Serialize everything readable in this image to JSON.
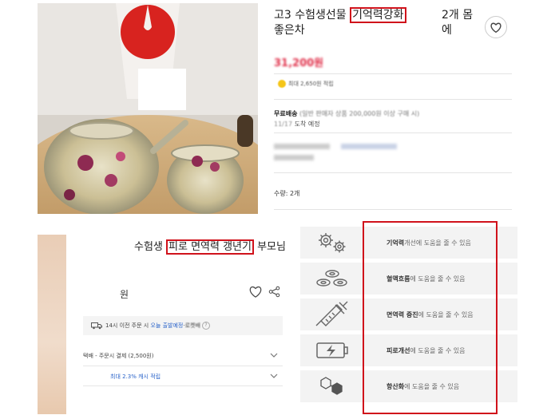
{
  "top": {
    "title_before": "고3 수험생선물 ",
    "title_highlight": "기억력강화",
    "title_count": "2개 몸에",
    "title_line2": "좋은차",
    "price_blurred": "31,200원",
    "point_badge": "최대 2,650원 적립",
    "shipping_label": "무료배송",
    "shipping_detail": "(일반 판매자 상품 200,000원 이상 구매 시)",
    "arrival_date": "11/17",
    "arrival_suffix": " 도착 예정",
    "quantity": "수량: 2개"
  },
  "bottom": {
    "title_before": "수험생 ",
    "title_highlight": "피로 면역력 갱년기",
    "title_after": " 부모님",
    "won": "원",
    "delivery_prefix": "14시 이전 주문 시",
    "delivery_blue": "오늘 출발예정",
    "delivery_suffix": " · ",
    "delivery_extra": "로켓배",
    "shipping_row": "택배 - 주문시 결제 (2,500원)",
    "cash_row": "최대 2.3% 캐시 적립"
  },
  "benefits": [
    {
      "icon": "gears-icon",
      "bold": "기억력",
      "rest": " 개선에 도움을 줄 수 있음"
    },
    {
      "icon": "blood-cells-icon",
      "bold": "혈액흐름",
      "rest": "에 도움을 줄 수 있음"
    },
    {
      "icon": "syringe-icon",
      "bold": "면역력 증진",
      "rest": "에 도움을 줄 수 있음"
    },
    {
      "icon": "battery-charge-icon",
      "bold": "피로개선",
      "rest": "에 도움을 줄 수 있음"
    },
    {
      "icon": "molecule-icon",
      "bold": "항산화",
      "rest": "에 도움을 줄 수 있음"
    }
  ],
  "colors": {
    "highlight_border": "#d0121b",
    "link_blue": "#2a63c9",
    "price_red": "#e0304a"
  }
}
